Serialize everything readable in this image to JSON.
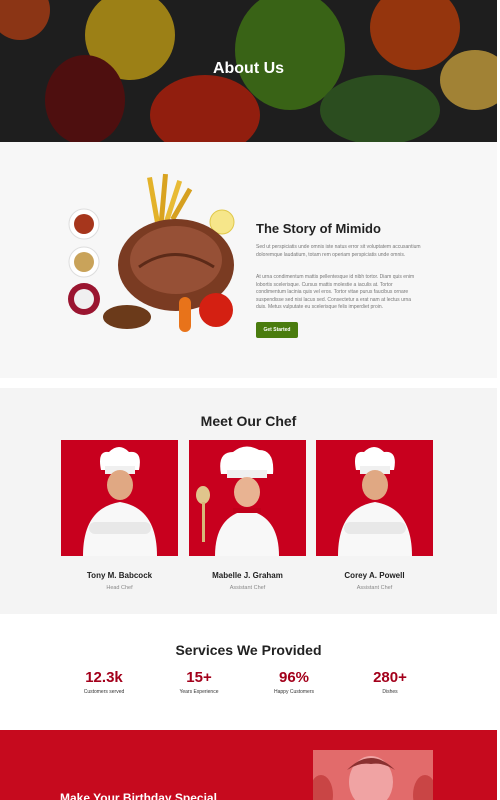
{
  "hero": {
    "title": "About Us"
  },
  "story": {
    "title": "The Story of Mimido",
    "paragraph1": "Sed ut perspiciatis unde omnis iste natus error sit voluptatem accusantium doloremque laudatium, totam rem operiam perspiciatis unde omnis.",
    "paragraph2": "At urna condimentum mattis pellentesque id nibh tortor. Diam quis enim lobortis scelerisque. Cursus mattis molestie a iaculis at. Tortor condimentum lacinia quis vel eros. Tortor vitae purus faucibus ornare suspendisse sed nisi lacus sed. Consectetur a erat nam at lectus urna duis. Metus vulputate eu scelerisque felis imperdiet proin.",
    "button_label": "Get Started"
  },
  "chefs": {
    "title": "Meet Our Chef",
    "items": [
      {
        "name": "Tony M. Babcock",
        "role": "Head Chef"
      },
      {
        "name": "Mabelle J. Graham",
        "role": "Assistant Chef"
      },
      {
        "name": "Corey A. Powell",
        "role": "Assistant Chef"
      }
    ]
  },
  "services": {
    "title": "Services We Provided",
    "stats": [
      {
        "value": "12.3k",
        "label": "Customers served"
      },
      {
        "value": "15+",
        "label": "Years Experience"
      },
      {
        "value": "96%",
        "label": "Happy Customers"
      },
      {
        "value": "280+",
        "label": "Dishes"
      }
    ]
  },
  "promo": {
    "heading": "Make Your Birthday Special"
  },
  "colors": {
    "accent_red": "#c60a1e",
    "stat_red": "#a3001b",
    "button_green": "#4a7c0e"
  }
}
